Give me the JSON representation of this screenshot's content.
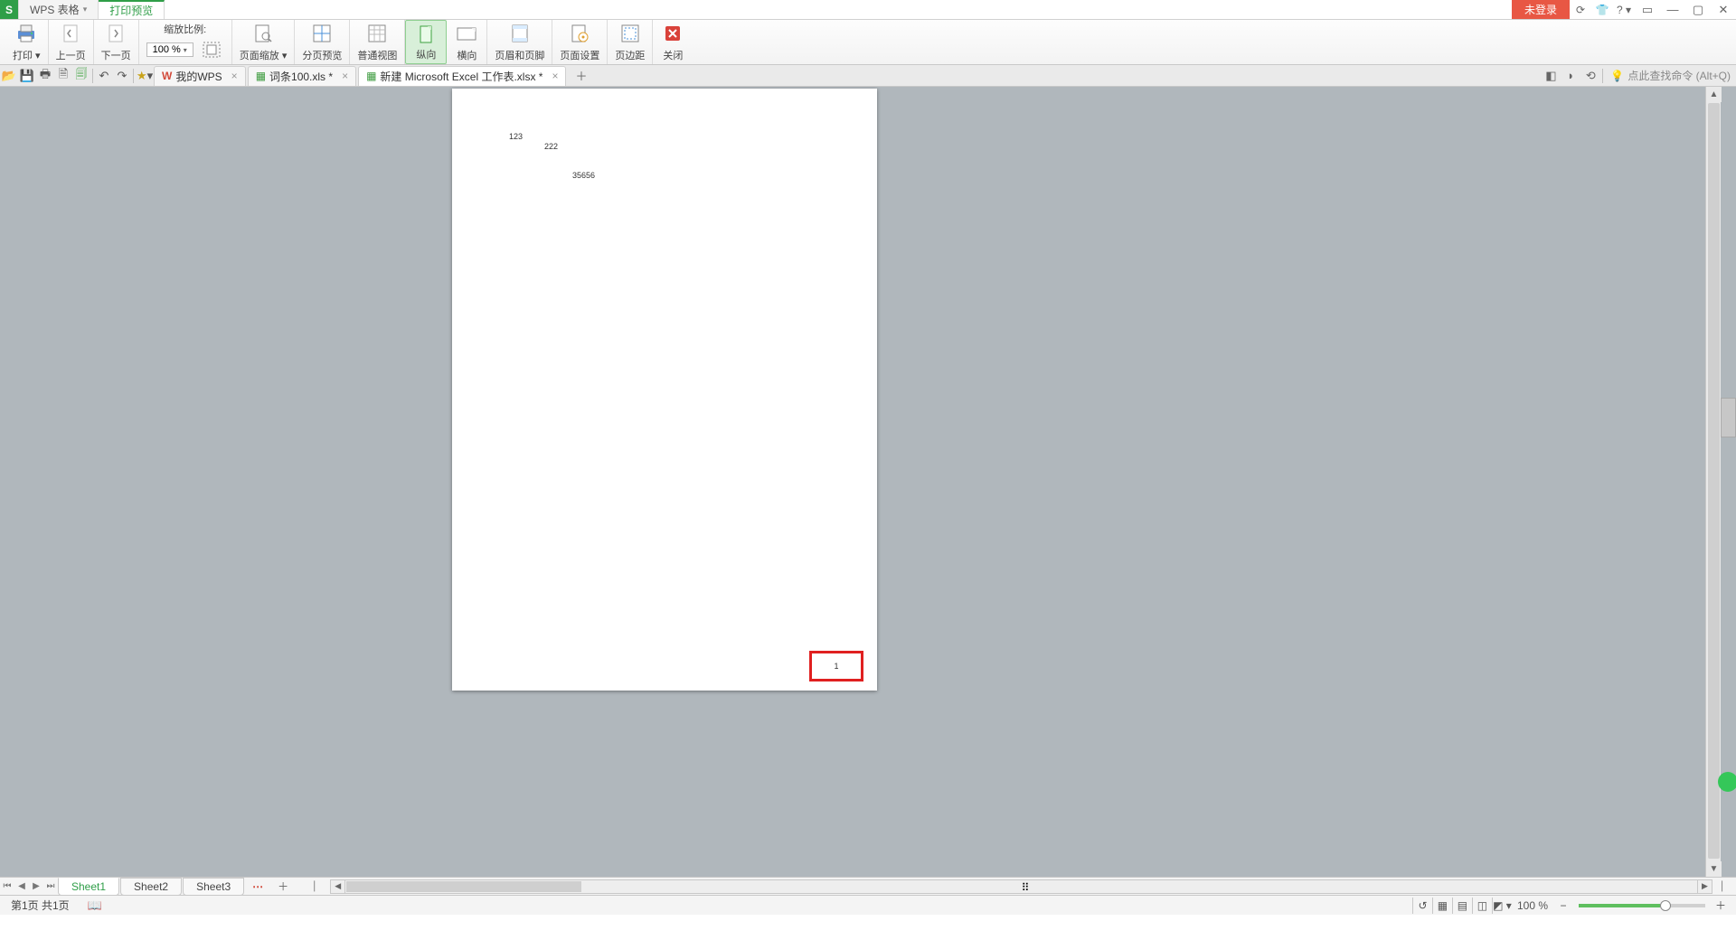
{
  "app": {
    "name": "WPS 表格",
    "mode_tab": "打印预览"
  },
  "window": {
    "login": "未登录",
    "search_hint": "点此查找命令 (Alt+Q)"
  },
  "ribbon": {
    "print": "打印",
    "prev_page": "上一页",
    "next_page": "下一页",
    "zoom_label": "缩放比例:",
    "zoom_value": "100 %",
    "page_zoom": "页面缩放",
    "split_preview": "分页预览",
    "normal_view": "普通视图",
    "portrait": "纵向",
    "landscape": "横向",
    "header_footer": "页眉和页脚",
    "page_setup": "页面设置",
    "margins": "页边距",
    "close": "关闭"
  },
  "doc_tabs": [
    {
      "label": "我的WPS",
      "icon": "w"
    },
    {
      "label": "词条100.xls *",
      "icon": "xl"
    },
    {
      "label": "新建 Microsoft Excel 工作表.xlsx *",
      "icon": "xl",
      "active": true
    }
  ],
  "page_cells": {
    "c1": "123",
    "c2": "222",
    "c3": "35656",
    "page_number": "1"
  },
  "sheets": [
    "Sheet1",
    "Sheet2",
    "Sheet3"
  ],
  "status": {
    "page_info": "第1页 共1页",
    "zoom": "100 %"
  }
}
